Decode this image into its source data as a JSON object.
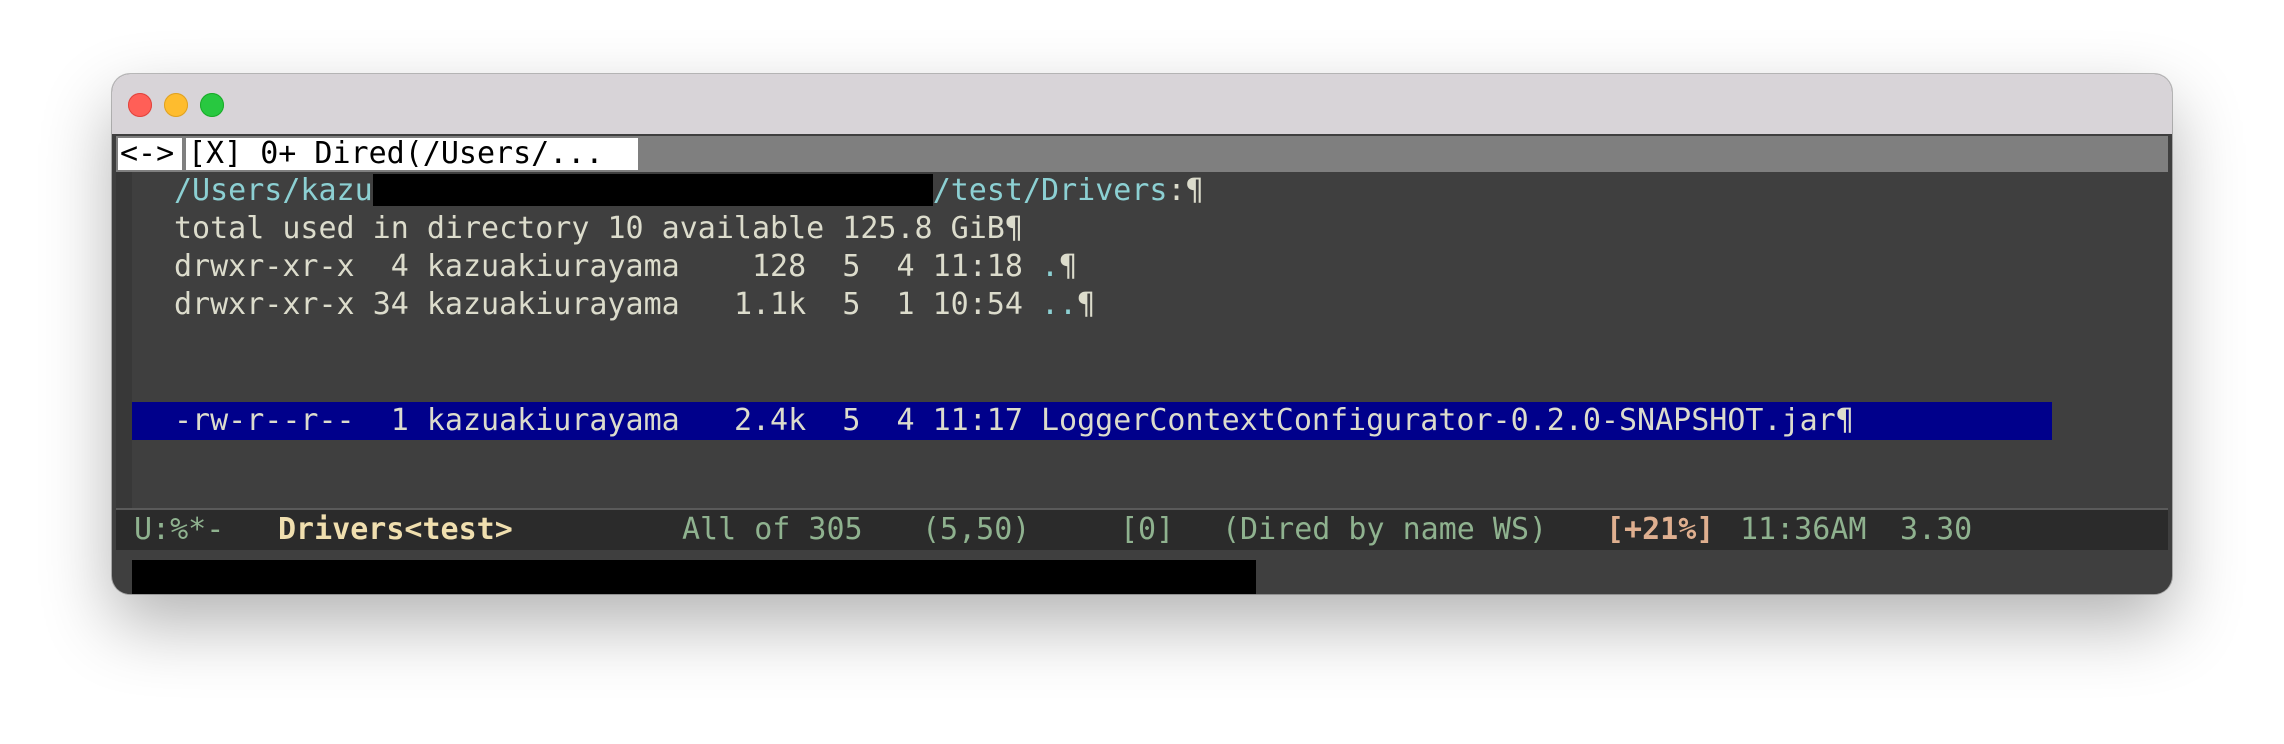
{
  "window": {
    "traffic_lights": [
      "close",
      "minimize",
      "zoom"
    ]
  },
  "tabbar": {
    "arrows": "<->",
    "tab_label": "[X] 0+ Dired(/Users/..."
  },
  "dired": {
    "header_prefix": "/Users/kazu",
    "header_suffix": "/test/Drivers",
    "header_colon": ":",
    "pilcrow": "¶",
    "total_line": "total used in directory 10 available 125.8 GiB",
    "entries": [
      {
        "perms": "drwxr-xr-x",
        "links": "4",
        "owner": "kazuakiurayama",
        "size": "128",
        "month": "5",
        "day": "4",
        "time": "11:18",
        "name": "."
      },
      {
        "perms": "drwxr-xr-x",
        "links": "34",
        "owner": "kazuakiurayama",
        "size": "1.1k",
        "month": "5",
        "day": "1",
        "time": "10:54",
        "name": ".."
      },
      {
        "perms": "-rw-r--r--",
        "links": "1",
        "owner": "kazuakiurayama",
        "size": "2.4k",
        "month": "5",
        "day": "4",
        "time": "11:17",
        "name": "LoggerContextConfigurator-0.2.0-SNAPSHOT.jar"
      }
    ]
  },
  "modeline": {
    "status": "U:%*-",
    "buffer_name": "Drivers<test>",
    "position": "All of 305",
    "cursor": "(5,50)",
    "count": "[0]",
    "mode": "(Dired by name WS)",
    "percent": "[+21%]",
    "time": "11:36AM",
    "load": "3.30"
  },
  "colors": {
    "background": "#3f3f3f",
    "foreground": "#dcdccc",
    "header": "#8cd0d3",
    "highlight": "#00008b",
    "modeline_fg": "#8fb28f"
  }
}
